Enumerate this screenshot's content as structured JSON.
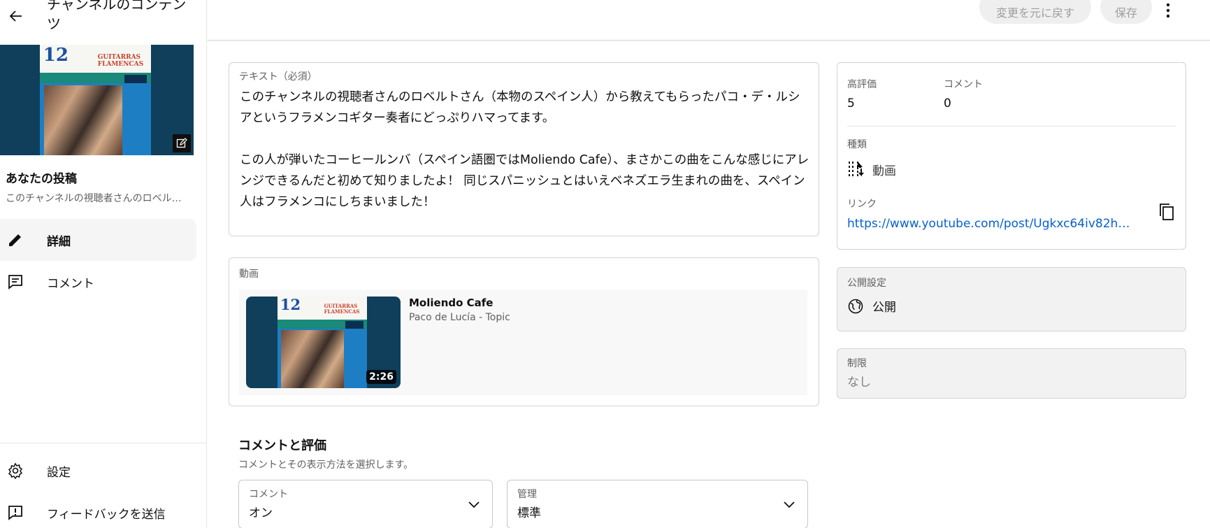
{
  "sidebar": {
    "title": "チャンネルのコンテンツ",
    "post_label": "あなたの投稿",
    "post_excerpt": "このチャンネルの視聴者さんのロベルトさん（本物のスペイン人）から教えてもらったパコ・デ・ルシアというフラメンコギター奏者にどっぷりハマってます。",
    "nav": [
      {
        "label": "詳細",
        "icon": "pencil-icon",
        "active": true
      },
      {
        "label": "コメント",
        "icon": "comment-icon",
        "active": false
      }
    ],
    "bottom": [
      {
        "label": "設定",
        "icon": "gear-icon"
      },
      {
        "label": "フィードバックを送信",
        "icon": "feedback-icon"
      }
    ]
  },
  "header": {
    "undo_label": "変更を元に戻す",
    "save_label": "保存"
  },
  "text_field": {
    "label": "テキスト（必須）",
    "value": "このチャンネルの視聴者さんのロベルトさん（本物のスペイン人）から教えてもらったパコ・デ・ルシアというフラメンコギター奏者にどっぷりハマってます。\n\nこの人が弾いたコーヒールンバ（スペイン語圏ではMoliendo Cafe）、まさかこの曲をこんな感じにアレンジできるんだと初めて知りましたよ！ 同じスパニッシュとはいえベネズエラ生まれの曲を、スペイン人はフラメンコにしちまいました！"
  },
  "video": {
    "label": "動画",
    "title": "Moliendo Cafe",
    "channel": "Paco de Lucía - Topic",
    "duration": "2:26",
    "album_num": "12",
    "album_text": "GUITARRAS FLAMENCAS"
  },
  "stats": {
    "likes_label": "高評価",
    "likes_value": "5",
    "comments_label": "コメント",
    "comments_value": "0",
    "type_label": "種類",
    "type_value": "動画",
    "link_label": "リンク",
    "link_value": "https://www.youtube.com/post/Ugkxc64iv82h0..."
  },
  "visibility": {
    "label": "公開設定",
    "value": "公開"
  },
  "restriction": {
    "label": "制限",
    "value": "なし"
  },
  "comments_section": {
    "title": "コメントと評価",
    "subtitle": "コメントとその表示方法を選択します。",
    "comment_select": {
      "label": "コメント",
      "value": "オン"
    },
    "moderation_select": {
      "label": "管理",
      "value": "標準"
    }
  },
  "colors": {
    "link": "#065fd4",
    "thumb_bg": "#0f3f5a",
    "muted": "#606060"
  }
}
